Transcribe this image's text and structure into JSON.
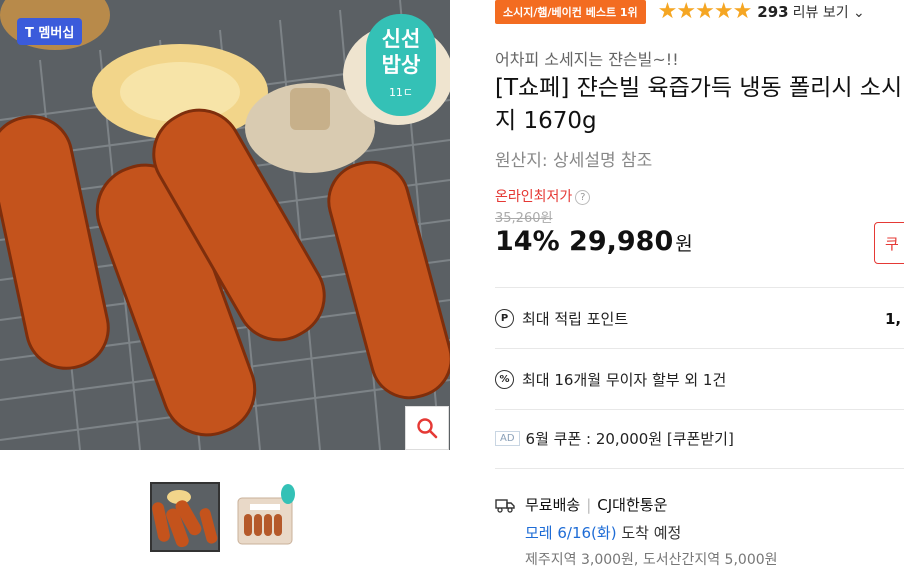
{
  "product_image": {
    "tmember_badge": "T 멤버십",
    "fresh_badge": {
      "line1": "신선",
      "line2": "밥상",
      "line3": "11ㄷ"
    }
  },
  "thumbnails": [
    {
      "label": "thumbnail-1",
      "active": true
    },
    {
      "label": "thumbnail-2",
      "active": false
    }
  ],
  "info": {
    "rank_badge": "소시지/햄/베이컨 베스트 1위",
    "stars": "★★★★★",
    "review_count": "293",
    "review_link": "리뷰 보기 ⌄",
    "subtitle": "어차피 소세지는 쟌슨빌~!!",
    "title": "[T쇼페] 쟌슨빌 육즙가득 냉동 폴리시 소시지 1670g",
    "origin": "원산지:  상세설명 참조",
    "lowest_label": "온라인최저가",
    "original_price": "35,260원",
    "discount": "14%",
    "price": "29,980",
    "currency": "원",
    "coupon_btn": "쿠",
    "points_label": "최대 적립 포인트",
    "points_value": "1,",
    "installment": "최대 16개월 무이자 할부 외 1건",
    "ad_tag": "AD",
    "coupon_text": "6월 쿠폰 : 20,000원 [쿠폰받기]",
    "shipping_free": "무료배송",
    "carrier": "CJ대한통운",
    "arrival_date": "모레 6/16(화)",
    "arrival_suffix": "도착 예정",
    "extra_fee": "제주지역 3,000원, 도서산간지역 5,000원"
  },
  "colors": {
    "accent_red": "#e53935",
    "rank_orange": "#f36c21",
    "star": "#f5a623",
    "fresh_teal": "#34c1b6",
    "arrival_blue": "#1e6cd6"
  }
}
